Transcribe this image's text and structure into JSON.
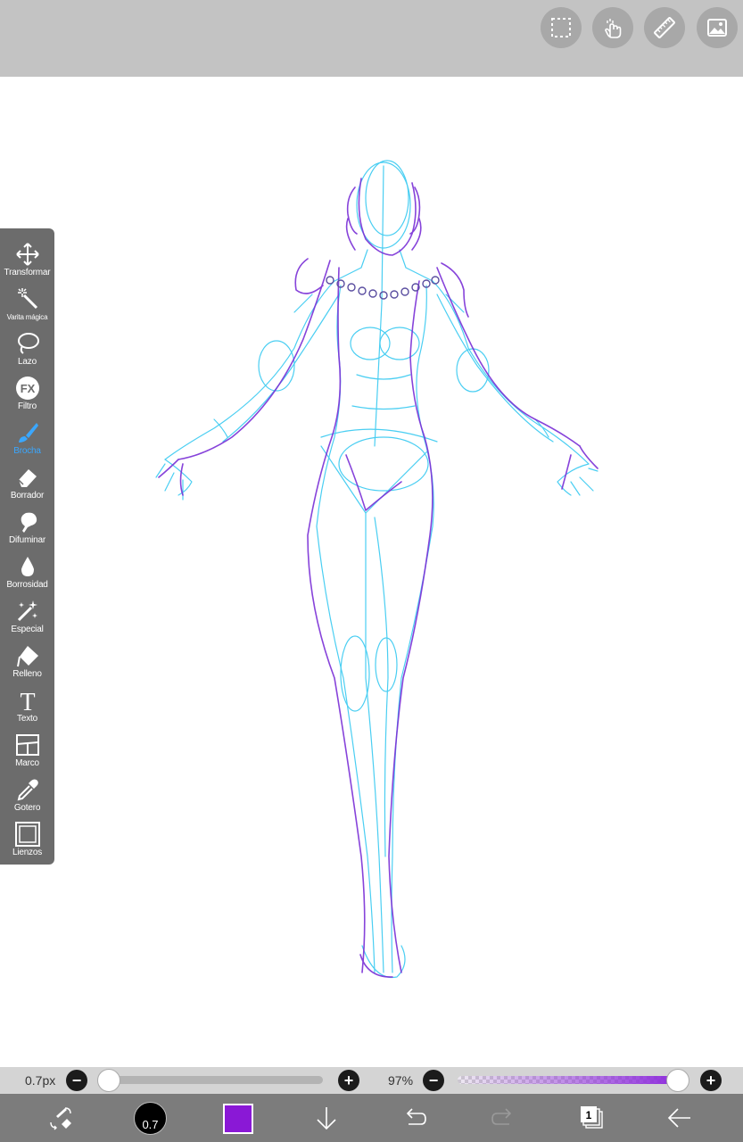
{
  "toolbar": {
    "tools": [
      {
        "label": "Transformar",
        "icon": "move-arrows-icon"
      },
      {
        "label": "Varita mágica",
        "icon": "magic-wand-icon"
      },
      {
        "label": "Lazo",
        "icon": "lasso-icon"
      },
      {
        "label": "Filtro",
        "icon": "fx-filter-icon"
      },
      {
        "label": "Brocha",
        "icon": "brush-icon",
        "active": true
      },
      {
        "label": "Borrador",
        "icon": "eraser-icon"
      },
      {
        "label": "Difuminar",
        "icon": "smudge-icon"
      },
      {
        "label": "Borrosidad",
        "icon": "blur-drop-icon"
      },
      {
        "label": "Especial",
        "icon": "special-sparkle-pen-icon"
      },
      {
        "label": "Relleno",
        "icon": "fill-bucket-icon"
      },
      {
        "label": "Texto",
        "icon": "text-t-icon"
      },
      {
        "label": "Marco",
        "icon": "frame-panel-icon"
      },
      {
        "label": "Gotero",
        "icon": "eyedropper-icon"
      },
      {
        "label": "Lienzos",
        "icon": "canvas-square-icon"
      }
    ]
  },
  "topbar": {
    "buttons": [
      "selection-icon",
      "gesture-hand-icon",
      "ruler-icon",
      "reference-image-icon"
    ]
  },
  "slider_bar": {
    "brush_size_label": "0.7px",
    "brush_size_fraction": 0.0,
    "opacity_label": "97%",
    "opacity_percent": 97,
    "minus": "−",
    "plus": "+"
  },
  "bottom_bar": {
    "brush_size_value": "0.7",
    "current_color": "#8a18d6",
    "layer_count": "1"
  },
  "colors": {
    "toolbar_bg": "#6c6c6c",
    "active_tool": "#3aa7ff",
    "sketch_cyan": "#2bc6f0",
    "sketch_purple": "#7a2fd6"
  }
}
